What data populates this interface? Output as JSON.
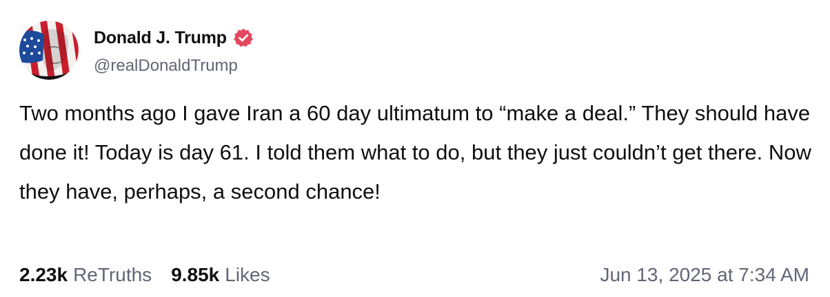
{
  "author": {
    "display_name": "Donald J. Trump",
    "handle": "@realDonaldTrump",
    "avatar_icon": "flag-portrait-avatar",
    "verified_icon": "verified-badge-icon",
    "verified_color": "#e4485f"
  },
  "post": {
    "text": "Two months ago I gave Iran a 60 day ultimatum to “make a deal.” They should have done it! Today is day 61. I told them what to do, but they just couldn’t get there. Now they have, perhaps, a second chance!"
  },
  "stats": {
    "retruths_count": "2.23k",
    "retruths_label": "ReTruths",
    "likes_count": "9.85k",
    "likes_label": "Likes"
  },
  "timestamp": "Jun 13, 2025 at 7:34 AM"
}
